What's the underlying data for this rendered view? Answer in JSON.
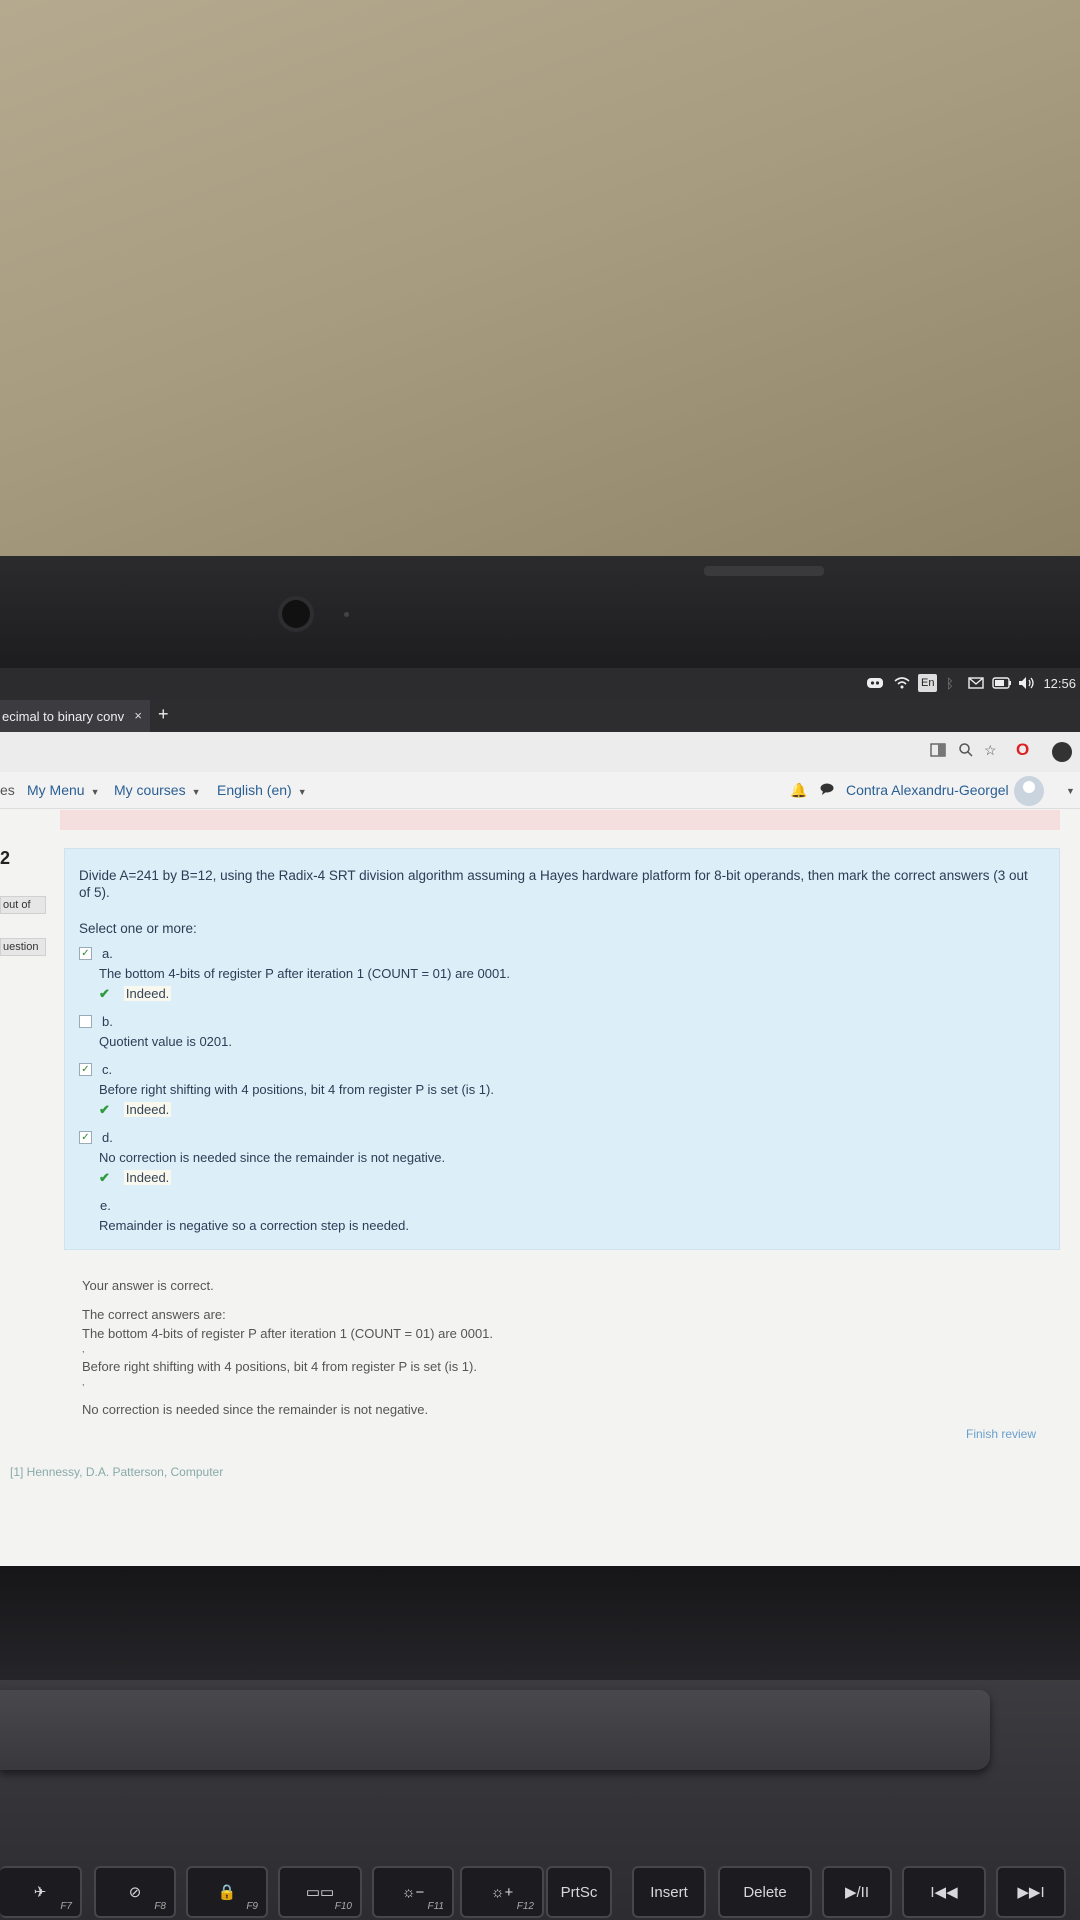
{
  "system_bar": {
    "language": "En",
    "clock": "12:56"
  },
  "browser": {
    "tab_title": "ecimal to binary conv",
    "tab_close": "×",
    "new_tab": "+"
  },
  "nav": {
    "cut_item": "es",
    "my_menu": "My Menu",
    "my_courses": "My courses",
    "language": "English (en)",
    "user_name": "Contra Alexandru-Georgel"
  },
  "sidebar": {
    "question_number": "2",
    "marks_label": "out of",
    "flag_label": "uestion"
  },
  "question": {
    "text": "Divide A=241 by B=12, using the Radix-4 SRT division algorithm assuming a Hayes hardware platform for 8-bit operands, then mark the correct answers (3 out of 5).",
    "prompt": "Select one or more:",
    "options": [
      {
        "letter": "a.",
        "text": "The bottom 4-bits of register P after iteration 1 (COUNT = 01) are 0001.",
        "checked": true,
        "feedback": "Indeed."
      },
      {
        "letter": "b.",
        "text": "Quotient value is 0201.",
        "checked": false,
        "feedback": ""
      },
      {
        "letter": "c.",
        "text": "Before right shifting with 4 positions, bit 4 from register P is set (is 1).",
        "checked": true,
        "feedback": "Indeed."
      },
      {
        "letter": "d.",
        "text": "No correction is needed since the remainder is not negative.",
        "checked": true,
        "feedback": "Indeed."
      },
      {
        "letter": "e.",
        "text": "Remainder is negative so a correction step is needed.",
        "checked": false,
        "feedback": ""
      }
    ]
  },
  "outcome": {
    "status": "Your answer is correct.",
    "heading": "The correct answers are:",
    "answers": [
      "The bottom 4-bits of register P after iteration 1 (COUNT = 01) are 0001.",
      "Before right shifting with 4 positions, bit 4 from register P is set (is 1).",
      "No correction is needed since the remainder is not negative."
    ],
    "separator": ","
  },
  "finish_review": "Finish review",
  "footer_link": "[1] Hennessy, D.A. Patterson, Computer",
  "keyboard": {
    "keys": [
      "F7",
      "F8",
      "F9",
      "F10",
      "F11",
      "F12",
      "PrtSc",
      "Insert",
      "Delete"
    ],
    "play_pause": "▶/II",
    "prev": "I◀◀",
    "next": "▶▶I"
  }
}
